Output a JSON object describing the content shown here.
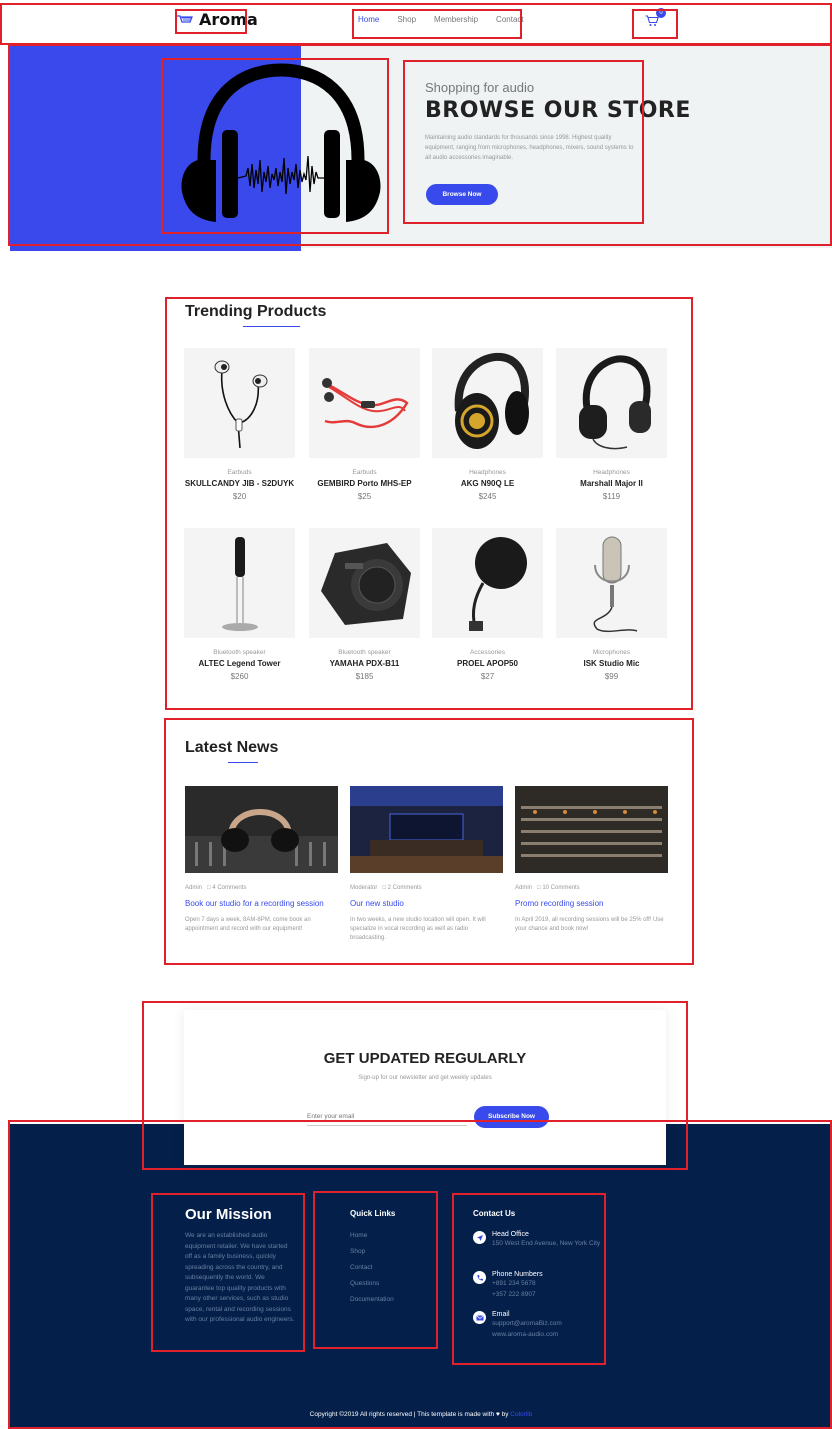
{
  "nav": {
    "logo": "Aroma",
    "menu": [
      "Home",
      "Shop",
      "Membership",
      "Contact"
    ],
    "cart_count": "0"
  },
  "hero": {
    "subtitle": "Shopping for audio",
    "title": "BROWSE OUR STORE",
    "text": "Maintaining audio standards for thousands since 1998. Highest quality equipment, ranging from microphones, headphones, mixers, sound systems to all audio accessories imaginable.",
    "button": "Browse Now"
  },
  "trending": {
    "title": "Trending Products",
    "products": [
      {
        "category": "Earbuds",
        "name": "SKULLCANDY JIB - S2DUYK",
        "price": "$20",
        "icon": "earbuds-white"
      },
      {
        "category": "Earbuds",
        "name": "GEMBIRD Porto MHS-EP",
        "price": "$25",
        "icon": "earbuds-red"
      },
      {
        "category": "Headphones",
        "name": "AKG N90Q LE",
        "price": "$245",
        "icon": "headphones-gold"
      },
      {
        "category": "Headphones",
        "name": "Marshall Major II",
        "price": "$119",
        "icon": "headphones-black"
      },
      {
        "category": "Bluetooth speaker",
        "name": "ALTEC Legend Tower",
        "price": "$260",
        "icon": "tower-speaker"
      },
      {
        "category": "Bluetooth speaker",
        "name": "YAMAHA PDX-B11",
        "price": "$185",
        "icon": "box-speaker"
      },
      {
        "category": "Accessories",
        "name": "PROEL APOP50",
        "price": "$27",
        "icon": "pop-filter"
      },
      {
        "category": "Microphones",
        "name": "ISK Studio Mic",
        "price": "$99",
        "icon": "studio-mic"
      }
    ]
  },
  "news": {
    "title": "Latest News",
    "items": [
      {
        "author": "Admin",
        "comments": "4 Comments",
        "title": "Book our studio for a recording session",
        "text": "Open 7 days a week, 8AM-8PM, come book an appointment and record with our equipment!"
      },
      {
        "author": "Moderator",
        "comments": "2 Comments",
        "title": "Our new studio",
        "text": "In two weeks, a new studio location will open. It will specialize in vocal recording as well as radio broadcasting."
      },
      {
        "author": "Admin",
        "comments": "10 Comments",
        "title": "Promo recording session",
        "text": "In April 2019, all recording sessions will be 25% off! Use your chance and book now!"
      }
    ]
  },
  "newsletter": {
    "title": "GET UPDATED REGULARLY",
    "subtitle": "Sign-up for our newsletter and get weekly updates",
    "placeholder": "Enter your email",
    "button": "Subscribe Now"
  },
  "footer": {
    "mission_title": "Our Mission",
    "mission_text": "We are an established audio equipment retailer. We have started off as a family business, quickly spreading across the country, and subsequently the world. We guarantee top quality products with many other services, such as studio space, rental and recording sessions with our professional audio engineers.",
    "links_title": "Quick Links",
    "links": [
      "Home",
      "Shop",
      "Contact",
      "Questions",
      "Documentation"
    ],
    "contact_title": "Contact Us",
    "head_office_label": "Head Office",
    "head_office": "150 West End Avenue, New York City",
    "phone_label": "Phone Numbers",
    "phone_1": "+891 234 5678",
    "phone_2": "+357 222 8907",
    "email_label": "Email",
    "email_1": "support@aromaBiz.com",
    "email_2": "www.aroma-audio.com",
    "copyright": "Copyright ©2019 All rights reserved | This template is made with",
    "copyright_by": "by",
    "copyright_brand": "Colorlib"
  },
  "colors": {
    "accent": "#384aeb",
    "footer_bg": "#04204a",
    "hero_bg": "#eff3f3",
    "highlight_box": "#e0202a"
  }
}
